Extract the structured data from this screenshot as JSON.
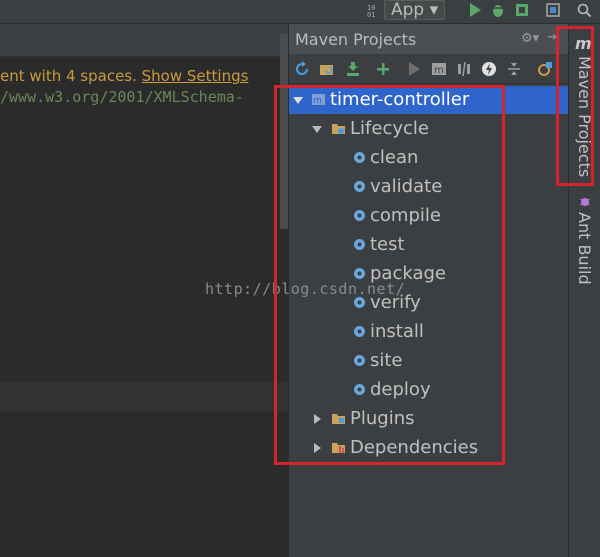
{
  "toolbar": {
    "run_config_label": "App ▾"
  },
  "editor": {
    "notice_text": "ent with 4 spaces. ",
    "notice_link": "Show Settings",
    "code_text": "/www.w3.org/2001/XMLSchema-",
    "watermark": "http://blog.csdn.net/"
  },
  "maven_panel": {
    "title": "Maven Projects",
    "root": {
      "label": "timer-controller"
    },
    "lifecycle": {
      "label": "Lifecycle"
    },
    "goals": [
      "clean",
      "validate",
      "compile",
      "test",
      "package",
      "verify",
      "install",
      "site",
      "deploy"
    ],
    "plugins": {
      "label": "Plugins"
    },
    "dependencies": {
      "label": "Dependencies"
    }
  },
  "right_strip": {
    "maven_tab": "Maven Projects",
    "ant_tab": "Ant Build"
  },
  "colors": {
    "accent_selection": "#2f65ca",
    "highlight_box": "#d6242c",
    "goal_icon": "#6aa6e0"
  }
}
